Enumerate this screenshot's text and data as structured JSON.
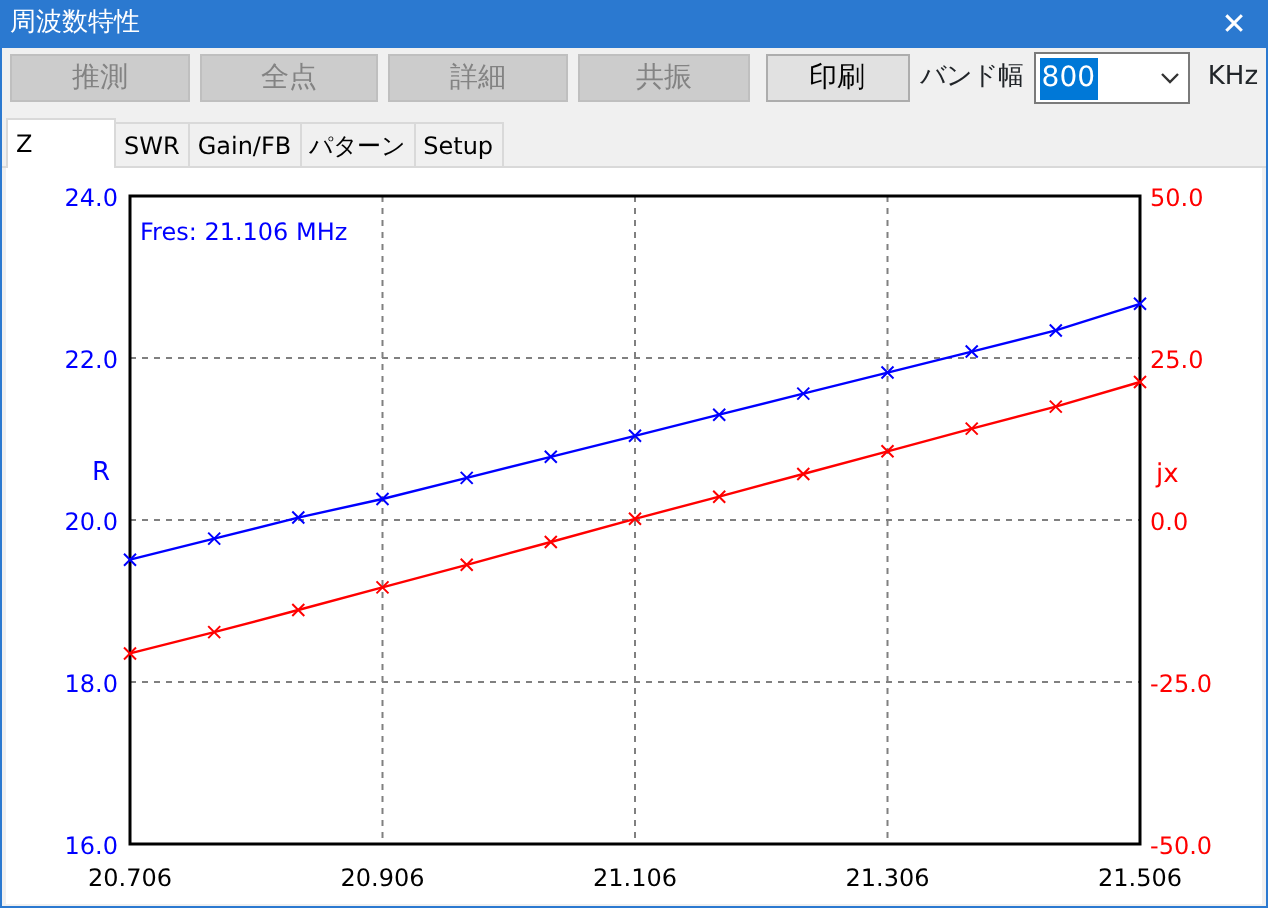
{
  "window": {
    "title": "周波数特性",
    "close": "✕"
  },
  "toolbar": {
    "buttons": [
      {
        "label": "推測",
        "disabled": true
      },
      {
        "label": "全点",
        "disabled": true
      },
      {
        "label": "詳細",
        "disabled": true
      },
      {
        "label": "共振",
        "disabled": true
      },
      {
        "label": "印刷",
        "disabled": false
      }
    ],
    "band_width": {
      "label": "バンド幅",
      "value": "800",
      "highlighted": true,
      "unit": "KHz"
    }
  },
  "tabs": [
    {
      "label": "Z",
      "selected": true
    },
    {
      "label": "SWR",
      "selected": false
    },
    {
      "label": "Gain/FB",
      "selected": false
    },
    {
      "label": "パターン",
      "selected": false
    },
    {
      "label": "Setup",
      "selected": false
    }
  ],
  "chart_data": {
    "type": "line",
    "grid": true,
    "x": [
      20.706,
      20.7727,
      20.8393,
      20.906,
      20.9727,
      21.0393,
      21.106,
      21.1727,
      21.2393,
      21.306,
      21.3727,
      21.4393,
      21.506
    ],
    "xlim": [
      20.706,
      21.506
    ],
    "xticks": [
      {
        "value": 20.706,
        "label": "20.706"
      },
      {
        "value": 20.906,
        "label": "20.906"
      },
      {
        "value": 21.106,
        "label": "21.106"
      },
      {
        "value": 21.306,
        "label": "21.306"
      },
      {
        "value": 21.506,
        "label": "21.506"
      }
    ],
    "ylim": [
      16,
      24
    ],
    "yticks": [
      {
        "value": 16,
        "label": "16.0"
      },
      {
        "value": 18,
        "label": "18.0"
      },
      {
        "value": 20,
        "label": "20.0"
      },
      {
        "value": 22,
        "label": "22.0"
      },
      {
        "value": 24,
        "label": "24.0"
      }
    ],
    "y2lim": [
      -50,
      50
    ],
    "y2ticks": [
      {
        "value": -50,
        "label": "-50.0"
      },
      {
        "value": -25,
        "label": "-25.0"
      },
      {
        "value": 0,
        "label": "0.0"
      },
      {
        "value": 25,
        "label": "25.0"
      },
      {
        "value": 50,
        "label": "50.0"
      }
    ],
    "series": [
      {
        "name": "R",
        "color": "#0000ff",
        "axis": "y",
        "marker": "x",
        "values": [
          19.51,
          19.77,
          20.03,
          20.26,
          20.52,
          20.78,
          21.04,
          21.3,
          21.56,
          21.82,
          22.08,
          22.34,
          22.67
        ]
      },
      {
        "name": "jx",
        "color": "#ff0000",
        "axis": "y2",
        "marker": "x",
        "values": [
          -20.6,
          -17.3,
          -13.9,
          -10.4,
          -6.9,
          -3.4,
          0.2,
          3.6,
          7.1,
          10.6,
          14.1,
          17.5,
          21.3
        ]
      }
    ],
    "annotations": [
      {
        "text": "Fres: 21.106 MHz"
      }
    ]
  }
}
